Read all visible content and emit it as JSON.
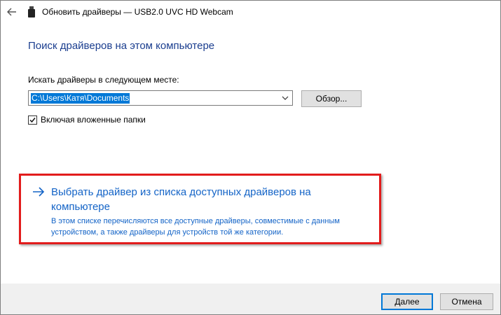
{
  "window": {
    "title": "Обновить драйверы — USB2.0 UVC HD Webcam"
  },
  "content": {
    "heading": "Поиск драйверов на этом компьютере",
    "path_label": "Искать драйверы в следующем месте:",
    "path_value": "C:\\Users\\Катя\\Documents",
    "browse_label": "Обзор...",
    "include_subfolders_label": "Включая вложенные папки",
    "include_subfolders_checked": true
  },
  "pick_option": {
    "title": "Выбрать драйвер из списка доступных драйверов на компьютере",
    "description": "В этом списке перечисляются все доступные драйверы, совместимые с данным устройством, а также драйверы для устройств той же категории."
  },
  "footer": {
    "next_label": "Далее",
    "cancel_label": "Отмена"
  },
  "colors": {
    "heading": "#1b3e8f",
    "link": "#1464c7",
    "highlight": "#e21c1c",
    "selection": "#0078d7"
  },
  "icons": {
    "back": "back-arrow-icon",
    "device": "usb-device-icon",
    "dropdown": "chevron-down-icon",
    "link_arrow": "right-arrow-icon",
    "check": "checkmark-icon"
  }
}
